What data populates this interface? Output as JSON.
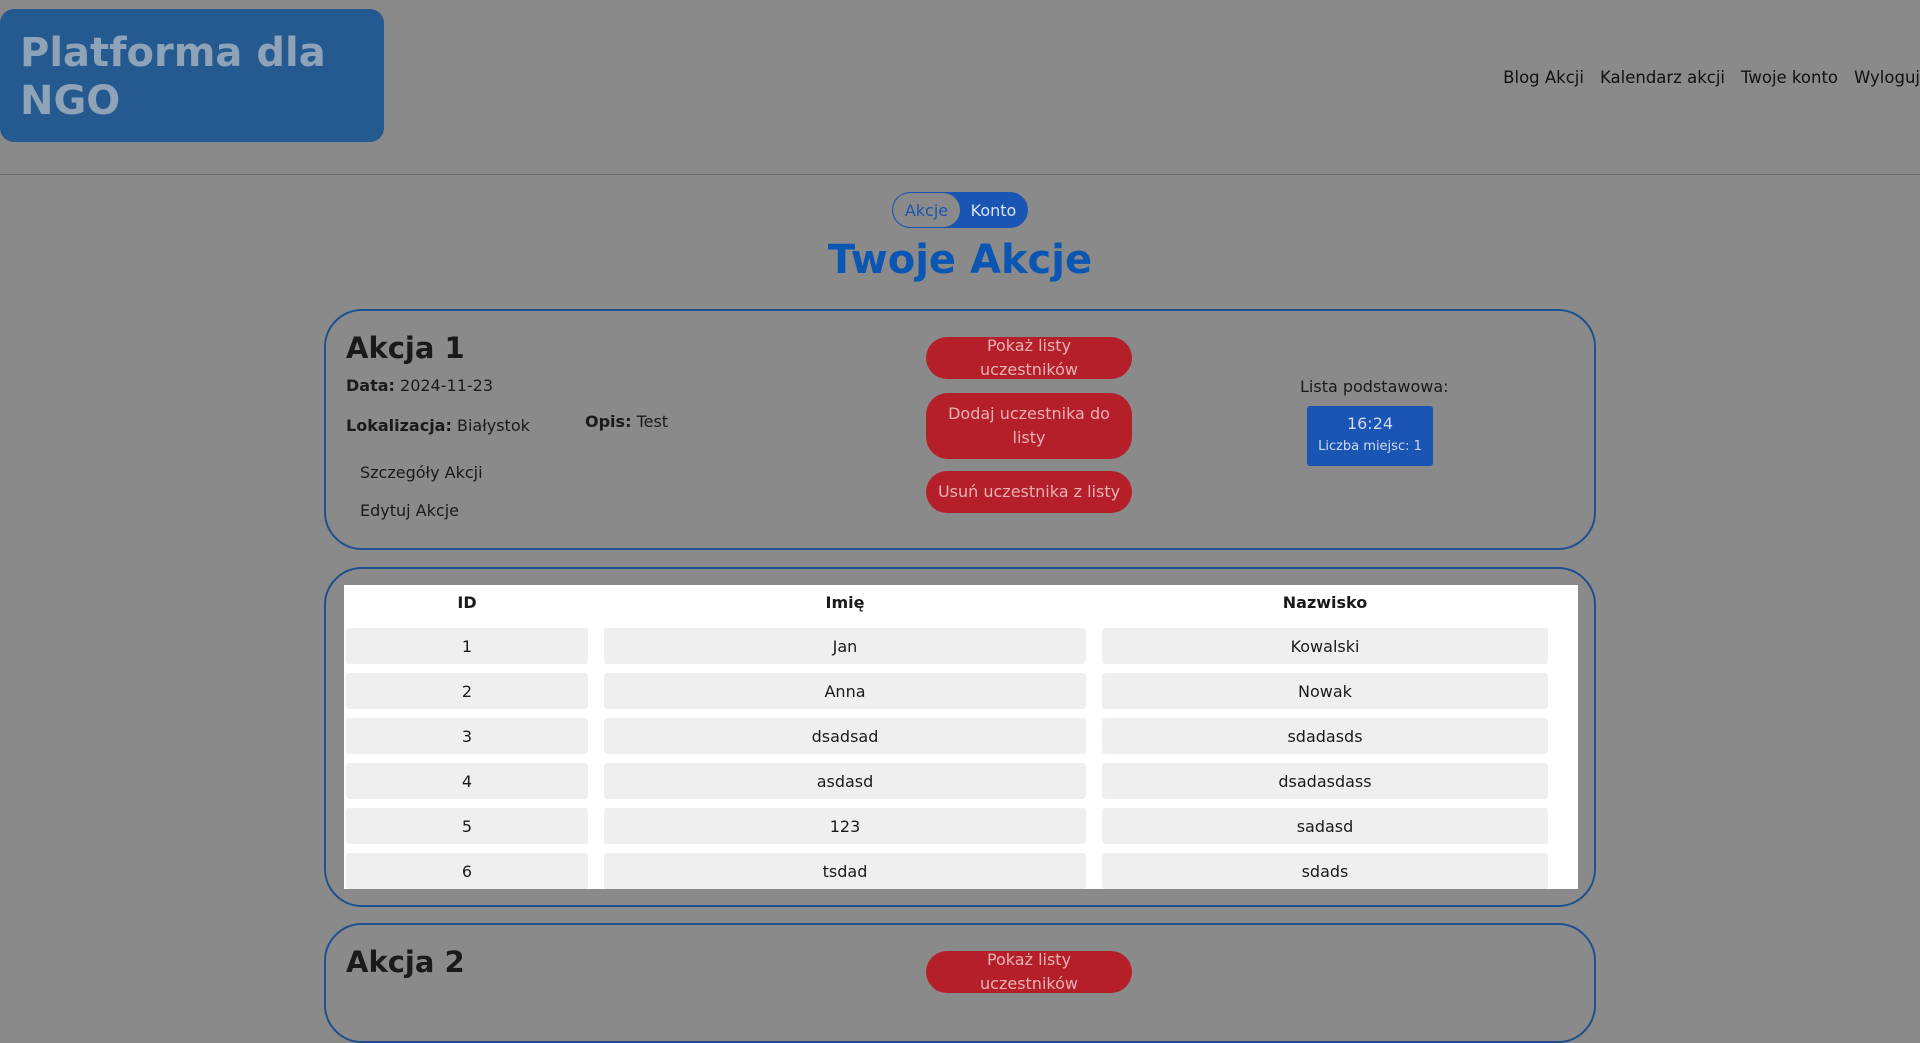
{
  "header": {
    "logo_line1": "Platforma dla",
    "logo_line2": "NGO",
    "nav": [
      "Blog Akcji",
      "Kalendarz akcji",
      "Twoje konto",
      "Wyloguj"
    ]
  },
  "toggle": {
    "akcje": "Akcje",
    "konto": "Konto"
  },
  "page_title": "Twoje Akcje",
  "akcja1": {
    "title": "Akcja 1",
    "data_label": "Data:",
    "data_value": "2024-11-23",
    "lokalizacja_label": "Lokalizacja:",
    "lokalizacja_value": "Białystok",
    "opis_label": "Opis:",
    "opis_value": "Test",
    "details_link": "Szczegóły Akcji",
    "edit_link": "Edytuj Akcje",
    "show_lists_button": "Pokaż listy uczestników",
    "add_participant_button": "Dodaj uczestnika do listy",
    "remove_participant_button": "Usuń uczestnika z listy",
    "lista_label": "Lista podstawowa:",
    "slot_time": "16:24",
    "slot_places": "Liczba miejsc: 1"
  },
  "participants": {
    "headers": [
      "ID",
      "Imię",
      "Nazwisko"
    ],
    "rows": [
      [
        "1",
        "Jan",
        "Kowalski"
      ],
      [
        "2",
        "Anna",
        "Nowak"
      ],
      [
        "3",
        "dsadsad",
        "sdadasds"
      ],
      [
        "4",
        "asdasd",
        "dsadasdass"
      ],
      [
        "5",
        "123",
        "sadasd"
      ],
      [
        "6",
        "tsdad",
        "sdads"
      ]
    ]
  },
  "akcja2": {
    "title": "Akcja 2",
    "show_lists_button": "Pokaż listy uczestników"
  },
  "colors": {
    "background": "#8a8a8a",
    "accent_blue": "#1a55b3",
    "danger_red": "#b51f2a",
    "title_blue": "#0b56b3"
  }
}
